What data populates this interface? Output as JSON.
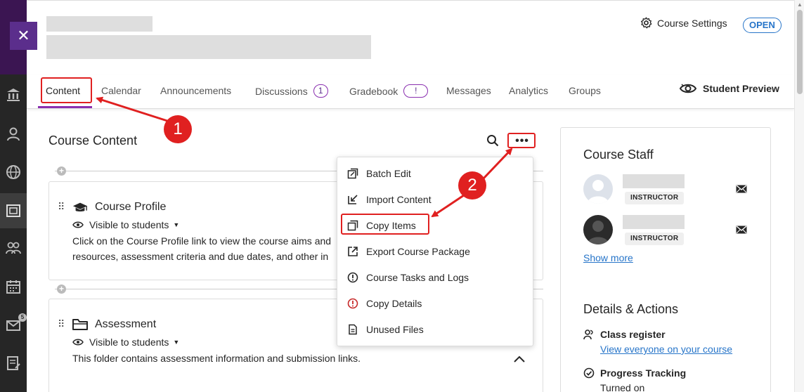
{
  "header": {
    "course_settings_label": "Course Settings",
    "status_badge": "OPEN"
  },
  "tabs": [
    {
      "label": "Content"
    },
    {
      "label": "Calendar"
    },
    {
      "label": "Announcements"
    },
    {
      "label": "Discussions",
      "badge": "1"
    },
    {
      "label": "Gradebook",
      "badge": "!"
    },
    {
      "label": "Messages"
    },
    {
      "label": "Analytics"
    },
    {
      "label": "Groups"
    }
  ],
  "student_preview_label": "Student Preview",
  "content": {
    "title": "Course Content",
    "more_label": "•••",
    "add_symbol": "+",
    "items": [
      {
        "title": "Course Profile",
        "visibility": "Visible to students",
        "description_line1": "Click on the Course Profile link to view the course aims and",
        "description_line2": "resources, assessment criteria and due dates, and other in",
        "icon": "graduation-cap-icon"
      },
      {
        "title": "Assessment",
        "visibility": "Visible to students",
        "description_line1": "This folder contains assessment information and submission links.",
        "icon": "folder-icon"
      }
    ]
  },
  "menu": {
    "items": [
      {
        "label": "Batch Edit",
        "icon": "batch-edit-icon"
      },
      {
        "label": "Import Content",
        "icon": "import-icon"
      },
      {
        "label": "Copy Items",
        "icon": "copy-icon"
      },
      {
        "label": "Export Course Package",
        "icon": "export-icon"
      },
      {
        "label": "Course Tasks and Logs",
        "icon": "alert-circle-icon"
      },
      {
        "label": "Copy Details",
        "icon": "alert-circle-red-icon"
      },
      {
        "label": "Unused Files",
        "icon": "file-icon"
      }
    ]
  },
  "staff": {
    "title": "Course Staff",
    "members": [
      {
        "role": "INSTRUCTOR"
      },
      {
        "role": "INSTRUCTOR"
      }
    ],
    "show_more": "Show more"
  },
  "details": {
    "title": "Details & Actions",
    "class_register": "Class register",
    "class_register_link": "View everyone on your course",
    "progress_tracking": "Progress Tracking",
    "progress_status": "Turned on"
  },
  "annotations": {
    "step1": "1",
    "step2": "2",
    "color": "#e02020"
  },
  "rail": {
    "close_label": "✕",
    "messages_badge": "5"
  }
}
